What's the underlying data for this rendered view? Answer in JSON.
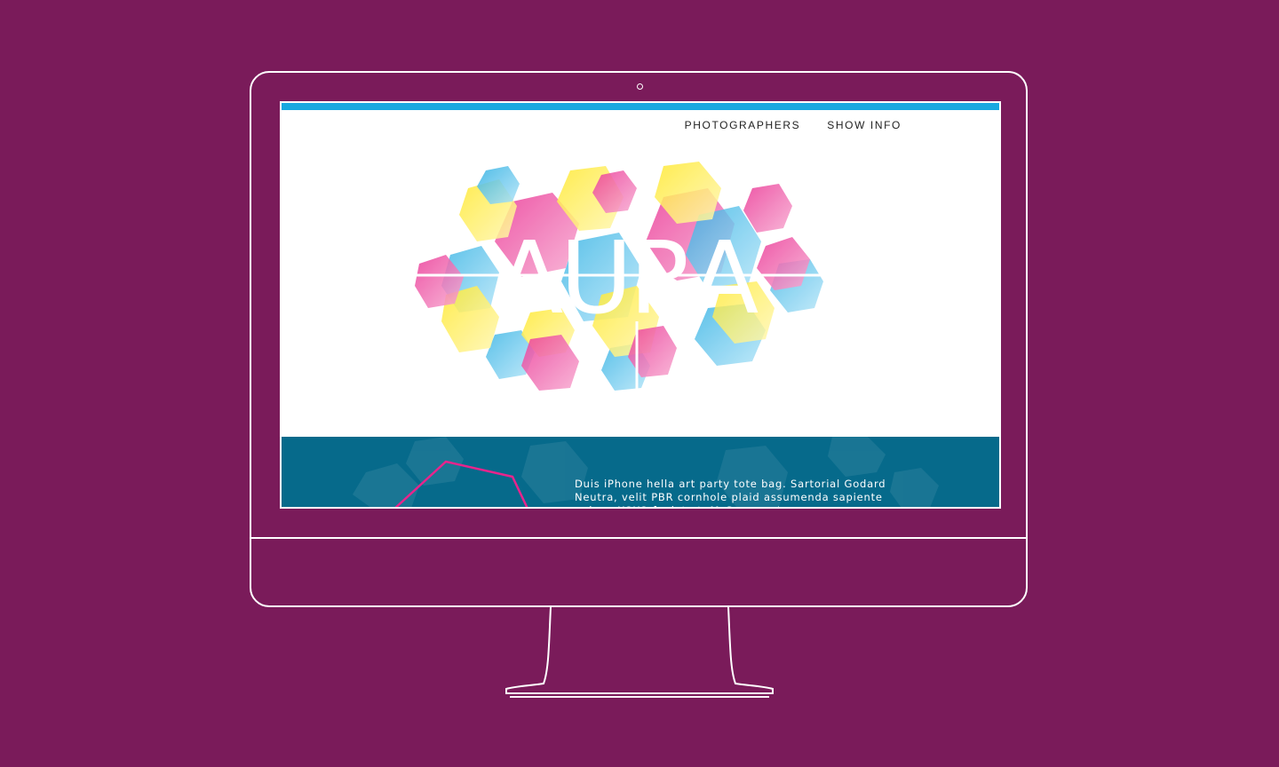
{
  "nav": {
    "items": [
      {
        "label": "PHOTOGRAPHERS"
      },
      {
        "label": "SHOW INFO"
      }
    ]
  },
  "hero": {
    "logo_text": "AURA"
  },
  "intro": {
    "text": "Duis iPhone hella art party tote bag. Sartorial Godard Neutra, velit PBR cornhole plaid assumenda sapiente quinoa XOXO fugiat et. McSweeney's ex"
  },
  "colors": {
    "background": "#7a1b5a",
    "accent_bar": "#1aa8e0",
    "section_teal": "#066a8b",
    "logo_magenta": "#e8248c",
    "logo_cyan": "#1aa8e0",
    "logo_yellow": "#ffe619"
  }
}
